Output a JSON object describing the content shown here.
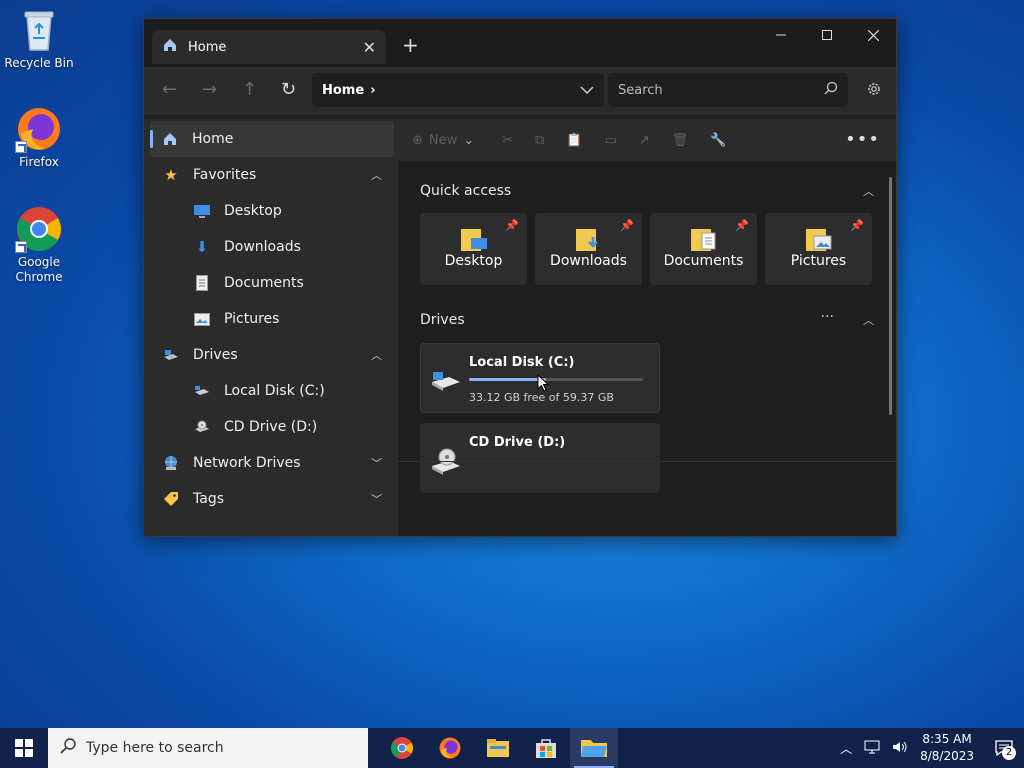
{
  "desktop": {
    "icons": [
      {
        "label": "Recycle Bin"
      },
      {
        "label": "Firefox"
      },
      {
        "label": "Google Chrome"
      }
    ]
  },
  "window": {
    "tab_title": "Home",
    "address": "Home",
    "search_placeholder": "Search",
    "sidebar": {
      "home": "Home",
      "favorites": "Favorites",
      "desktop": "Desktop",
      "downloads": "Downloads",
      "documents": "Documents",
      "pictures": "Pictures",
      "drives": "Drives",
      "local_disk": "Local Disk (C:)",
      "cd_drive": "CD Drive (D:)",
      "network_drives": "Network Drives",
      "tags": "Tags"
    },
    "toolbar": {
      "new_label": "New"
    },
    "quick_access": {
      "title": "Quick access",
      "items": [
        "Desktop",
        "Downloads",
        "Documents",
        "Pictures"
      ]
    },
    "drives": {
      "title": "Drives",
      "local": {
        "name": "Local Disk (C:)",
        "free_text": "33.12 GB free of 59.37 GB",
        "used_fraction": 0.442
      },
      "cd": {
        "name": "CD Drive (D:)"
      }
    }
  },
  "taskbar": {
    "search_placeholder": "Type here to search",
    "time": "8:35 AM",
    "date": "8/8/2023",
    "notification_count": "2"
  },
  "colors": {
    "accent": "#8ab4f8",
    "window_bg": "#202020",
    "taskbar_bg": "#10224a"
  }
}
